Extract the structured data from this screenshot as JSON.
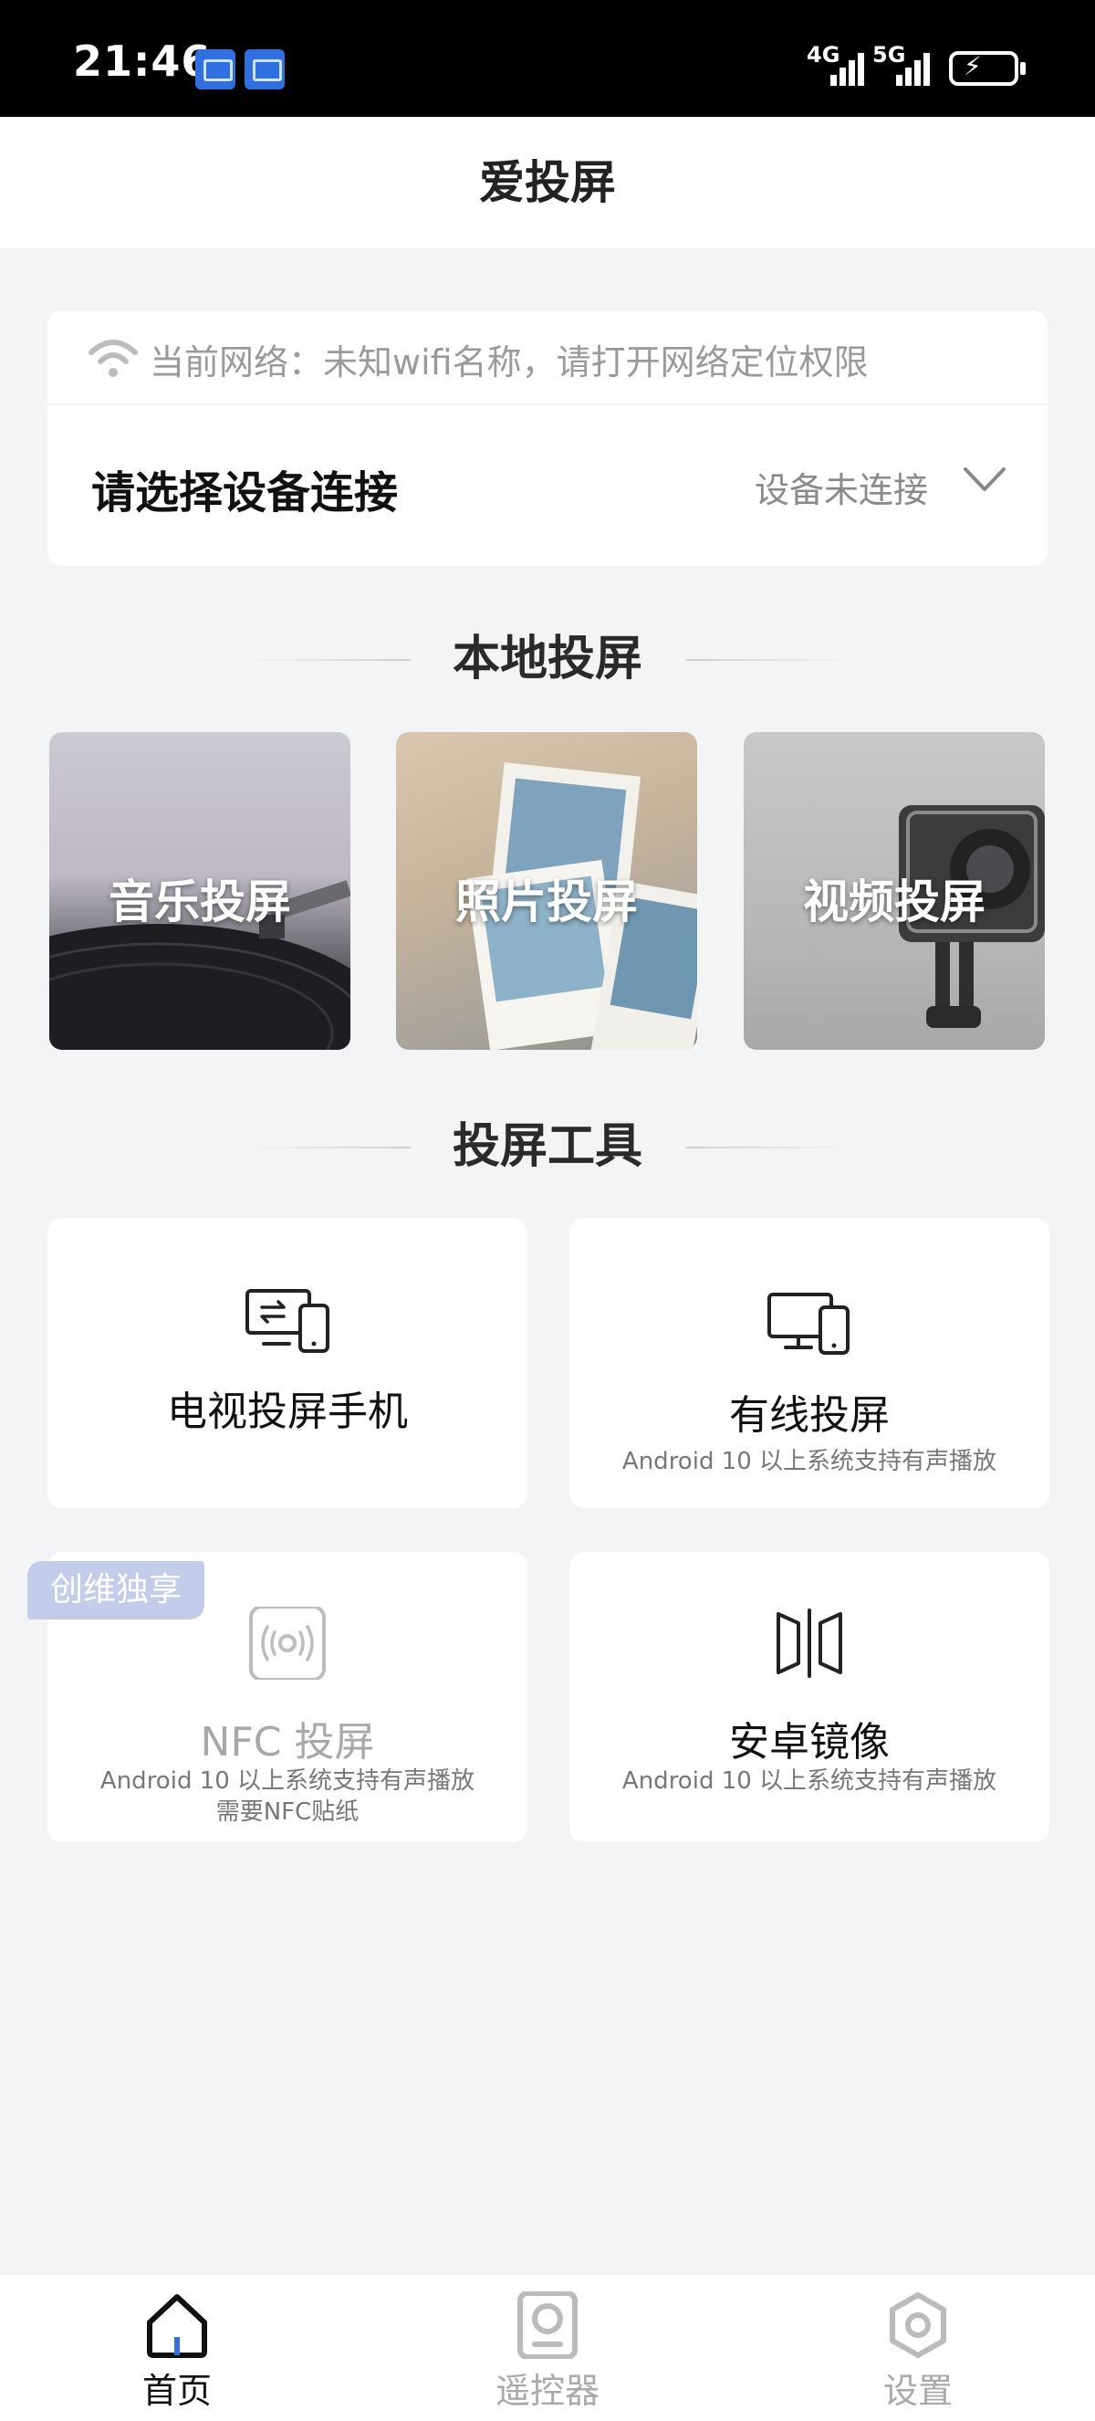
{
  "status_bar": {
    "time": "21:46",
    "signal1": "4G",
    "signal2": "5G"
  },
  "header": {
    "title": "爱投屏"
  },
  "device": {
    "network_text": "当前网络：未知wifi名称，请打开网络定位权限",
    "select_label": "请选择设备连接",
    "connection_status": "设备未连接"
  },
  "local": {
    "title": "本地投屏",
    "tiles": [
      {
        "label": "音乐投屏"
      },
      {
        "label": "照片投屏"
      },
      {
        "label": "视频投屏"
      }
    ]
  },
  "tools": {
    "title": "投屏工具",
    "items": [
      {
        "name": "电视投屏手机",
        "icon": "tv-to-phone-icon"
      },
      {
        "name": "有线投屏",
        "sub": "Android 10 以上系统支持有声播放",
        "icon": "wired-cast-icon"
      },
      {
        "name": "NFC 投屏",
        "sub": "Android 10 以上系统支持有声播放",
        "sub2": "需要NFC贴纸",
        "icon": "nfc-icon",
        "badge": "创维独享"
      },
      {
        "name": "安卓镜像",
        "sub": "Android 10 以上系统支持有声播放",
        "icon": "mirror-icon"
      }
    ]
  },
  "nav": {
    "items": [
      {
        "label": "首页",
        "active": true
      },
      {
        "label": "遥控器"
      },
      {
        "label": "设置"
      }
    ]
  },
  "colors": {
    "background": "#f3f4f6",
    "accent": "#2f6fe0",
    "badge": "#c3cde9"
  }
}
